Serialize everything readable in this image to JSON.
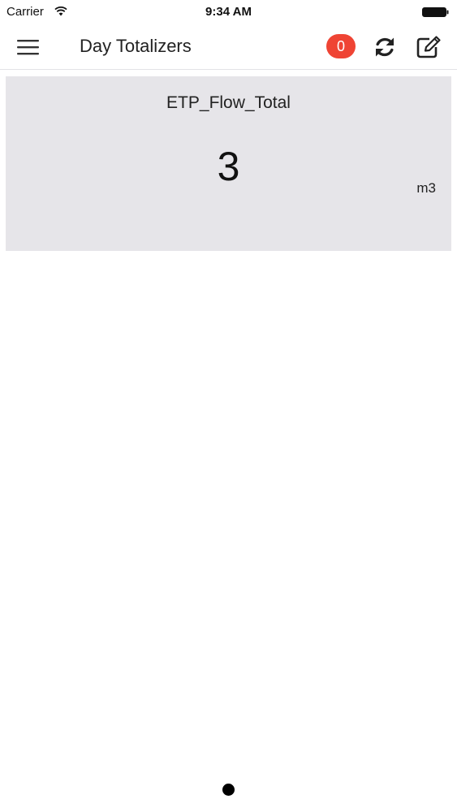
{
  "status_bar": {
    "carrier": "Carrier",
    "time": "9:34 AM",
    "icons": [
      "wifi-icon",
      "battery-icon"
    ]
  },
  "header": {
    "title": "Day Totalizers",
    "alert_count": "0",
    "icons": {
      "menu": "hamburger-menu-icon",
      "refresh": "refresh-icon",
      "edit": "edit-icon"
    }
  },
  "totalizers": [
    {
      "name": "ETP_Flow_Total",
      "value": "3",
      "unit": "m3"
    }
  ],
  "pager": {
    "pages": 1,
    "current": 1
  },
  "colors": {
    "badge_background": "#ef4434",
    "card_background": "#e6e5e9",
    "page_background": "#ffffff"
  }
}
